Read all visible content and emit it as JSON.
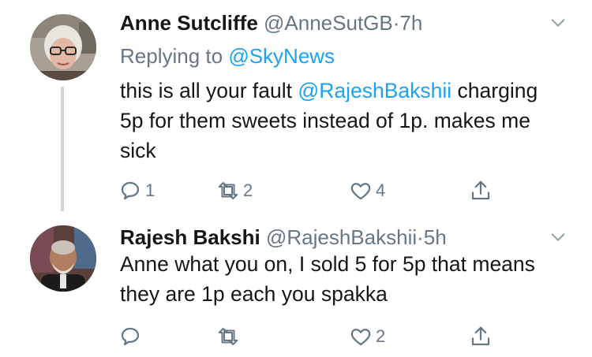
{
  "colors": {
    "link": "#1da1f2",
    "muted": "#657786",
    "text": "#14171a",
    "divider": "#e6ecf0"
  },
  "tweets": [
    {
      "name": "Anne Sutcliffe",
      "handle": "@AnneSutGB",
      "dot": "·",
      "time": "7h",
      "replying_prefix": "Replying to ",
      "replying_to": "@SkyNews",
      "text_before": "this is all your fault ",
      "mention": "@RajeshBakshii",
      "text_after": " charging 5p for them sweets instead of 1p. makes me sick",
      "reply_count": "1",
      "retweet_count": "2",
      "like_count": "4"
    },
    {
      "name": "Rajesh Bakshi",
      "handle": "@RajeshBakshii",
      "dot": "·",
      "time": "5h",
      "text": "Anne what you on, I sold 5 for 5p that means they are 1p each you spakka",
      "reply_count": "",
      "retweet_count": "",
      "like_count": "2"
    }
  ],
  "icons": {
    "reply": "reply-icon",
    "retweet": "retweet-icon",
    "like": "heart-icon",
    "share": "share-icon",
    "menu": "chevron-down-icon"
  }
}
